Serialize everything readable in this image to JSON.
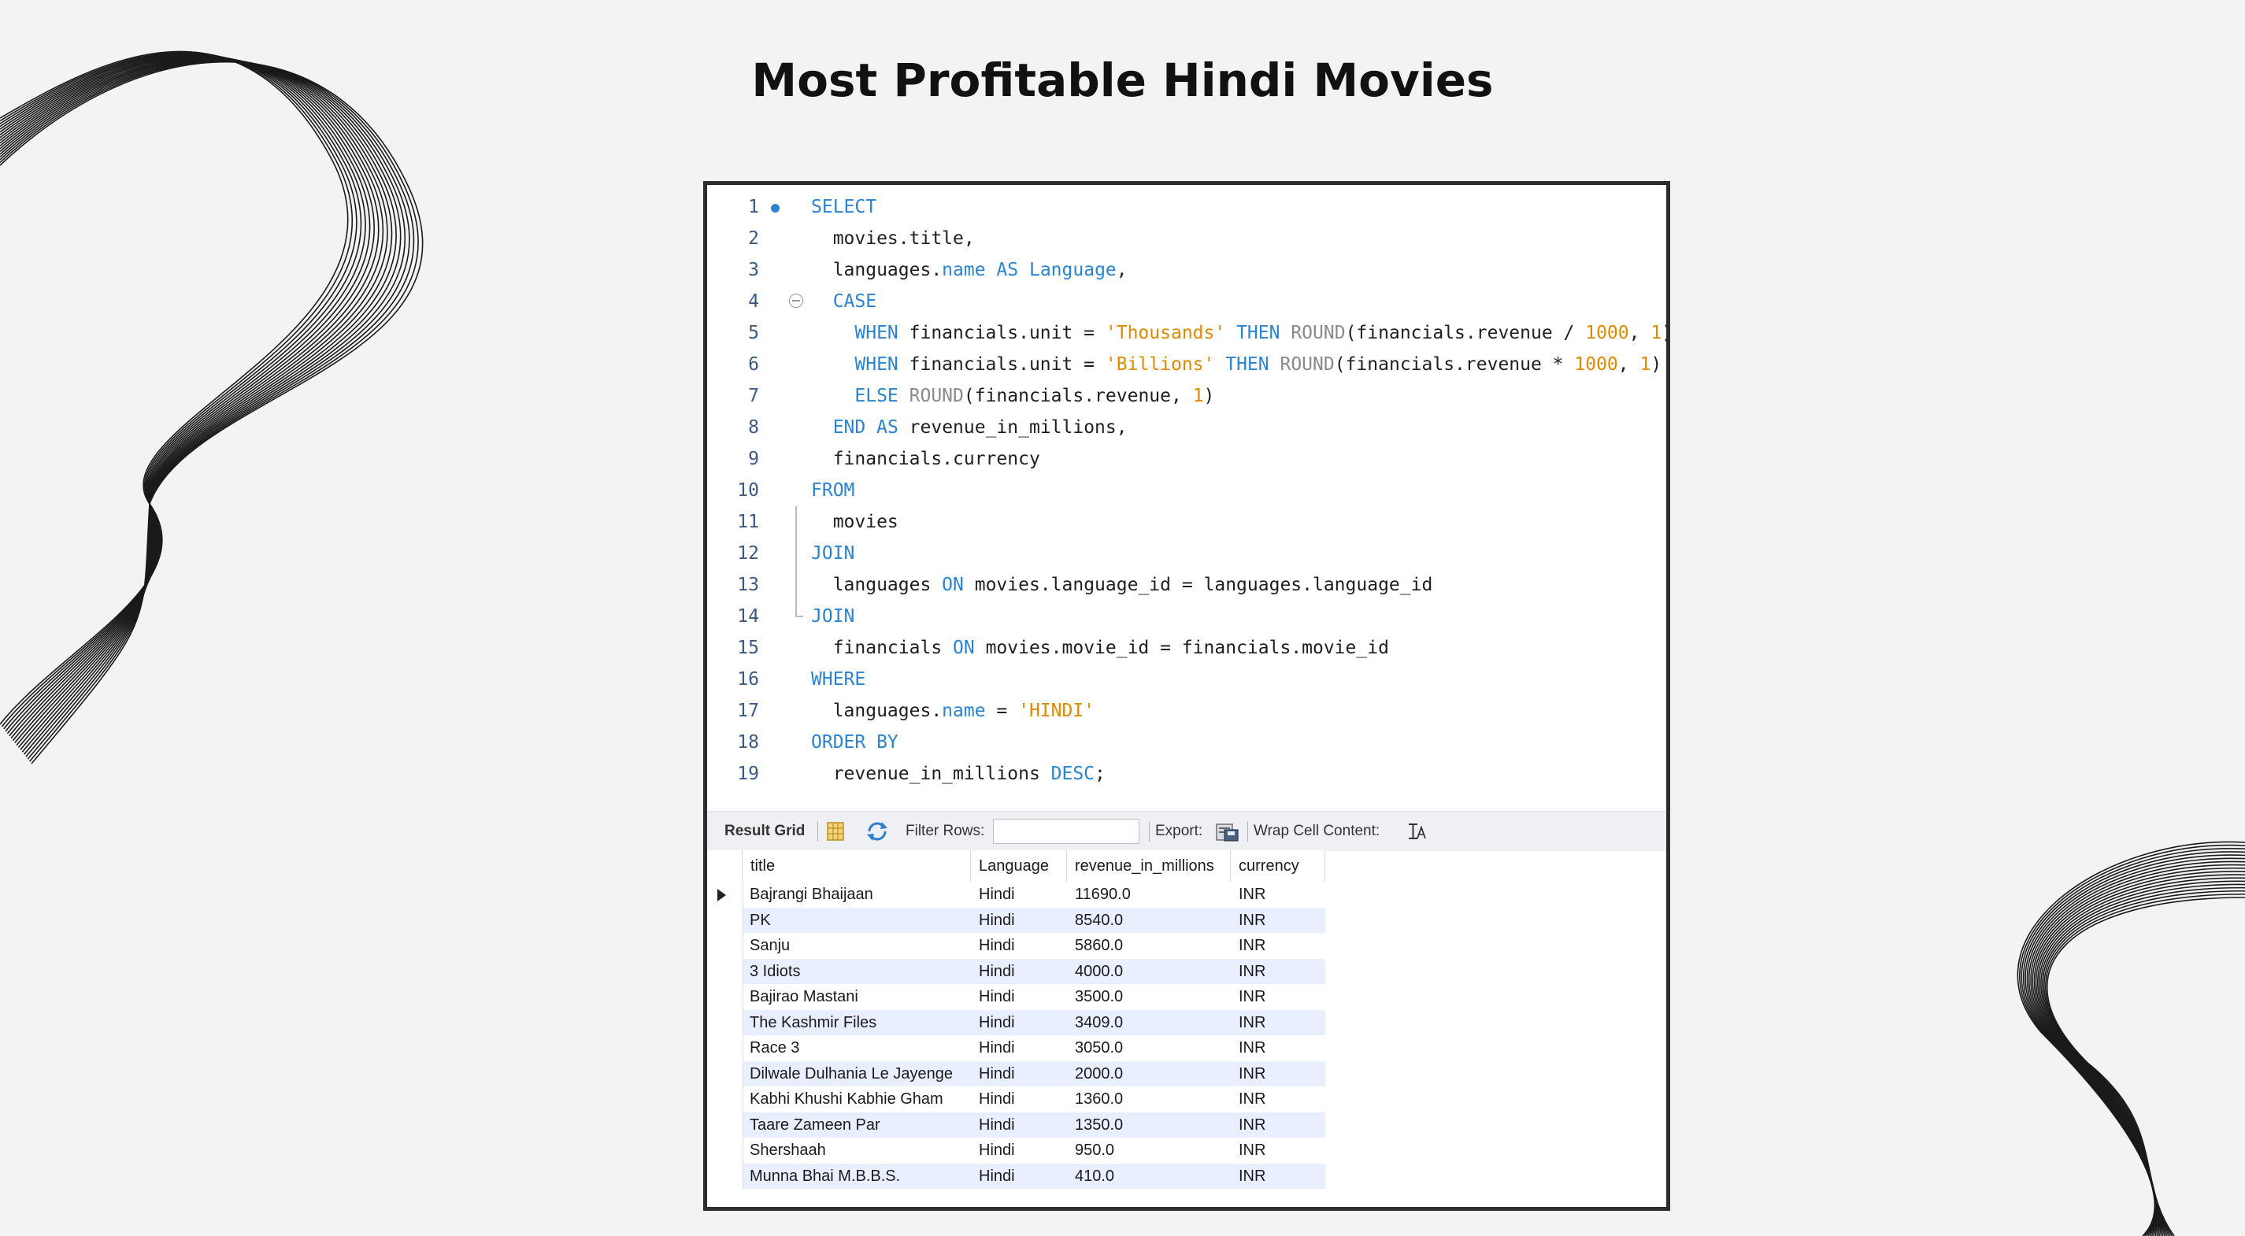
{
  "page": {
    "title": "Most Profitable Hindi Movies"
  },
  "colors": {
    "background": "#f2f3f5",
    "keyword": "#2a84d4",
    "string": "#e08a00",
    "function": "#8a8a8a",
    "line_number": "#3b5a85",
    "alt_row": "#e9efff"
  },
  "editor": {
    "lines": [
      {
        "n": "1",
        "segments": [
          [
            "kw",
            "SELECT"
          ]
        ]
      },
      {
        "n": "2",
        "segments": [
          [
            "t",
            "  movies.title,"
          ]
        ]
      },
      {
        "n": "3",
        "segments": [
          [
            "t",
            "  languages."
          ],
          [
            "kw",
            "name"
          ],
          [
            "t",
            " "
          ],
          [
            "kw",
            "AS"
          ],
          [
            "t",
            " "
          ],
          [
            "kw",
            "Language"
          ],
          [
            "t",
            ","
          ]
        ]
      },
      {
        "n": "4",
        "segments": [
          [
            "t",
            "  "
          ],
          [
            "kw",
            "CASE"
          ]
        ]
      },
      {
        "n": "5",
        "segments": [
          [
            "t",
            "    "
          ],
          [
            "kw",
            "WHEN"
          ],
          [
            "t",
            " financials.unit = "
          ],
          [
            "str",
            "'Thousands'"
          ],
          [
            "t",
            " "
          ],
          [
            "kw",
            "THEN"
          ],
          [
            "t",
            " "
          ],
          [
            "fn",
            "ROUND"
          ],
          [
            "t",
            "(financials.revenue / "
          ],
          [
            "num",
            "1000"
          ],
          [
            "t",
            ", "
          ],
          [
            "num",
            "1"
          ],
          [
            "t",
            ")"
          ]
        ]
      },
      {
        "n": "6",
        "segments": [
          [
            "t",
            "    "
          ],
          [
            "kw",
            "WHEN"
          ],
          [
            "t",
            " financials.unit = "
          ],
          [
            "str",
            "'Billions'"
          ],
          [
            "t",
            " "
          ],
          [
            "kw",
            "THEN"
          ],
          [
            "t",
            " "
          ],
          [
            "fn",
            "ROUND"
          ],
          [
            "t",
            "(financials.revenue * "
          ],
          [
            "num",
            "1000"
          ],
          [
            "t",
            ", "
          ],
          [
            "num",
            "1"
          ],
          [
            "t",
            ")"
          ]
        ]
      },
      {
        "n": "7",
        "segments": [
          [
            "t",
            "    "
          ],
          [
            "kw",
            "ELSE"
          ],
          [
            "t",
            " "
          ],
          [
            "fn",
            "ROUND"
          ],
          [
            "t",
            "(financials.revenue, "
          ],
          [
            "num",
            "1"
          ],
          [
            "t",
            ")"
          ]
        ]
      },
      {
        "n": "8",
        "segments": [
          [
            "t",
            "  "
          ],
          [
            "kw",
            "END"
          ],
          [
            "t",
            " "
          ],
          [
            "kw",
            "AS"
          ],
          [
            "t",
            " revenue_in_millions,"
          ]
        ]
      },
      {
        "n": "9",
        "segments": [
          [
            "t",
            "  financials.currency"
          ]
        ]
      },
      {
        "n": "10",
        "segments": [
          [
            "kw",
            "FROM"
          ]
        ]
      },
      {
        "n": "11",
        "segments": [
          [
            "t",
            "  movies"
          ]
        ]
      },
      {
        "n": "12",
        "segments": [
          [
            "kw",
            "JOIN"
          ]
        ]
      },
      {
        "n": "13",
        "segments": [
          [
            "t",
            "  languages "
          ],
          [
            "kw",
            "ON"
          ],
          [
            "t",
            " movies.language_id = languages.language_id"
          ]
        ]
      },
      {
        "n": "14",
        "segments": [
          [
            "kw",
            "JOIN"
          ]
        ]
      },
      {
        "n": "15",
        "segments": [
          [
            "t",
            "  financials "
          ],
          [
            "kw",
            "ON"
          ],
          [
            "t",
            " movies.movie_id = financials.movie_id"
          ]
        ]
      },
      {
        "n": "16",
        "segments": [
          [
            "kw",
            "WHERE"
          ]
        ]
      },
      {
        "n": "17",
        "segments": [
          [
            "t",
            "  languages."
          ],
          [
            "kw",
            "name"
          ],
          [
            "t",
            " = "
          ],
          [
            "str",
            "'HINDI'"
          ]
        ]
      },
      {
        "n": "18",
        "segments": [
          [
            "kw",
            "ORDER BY"
          ]
        ]
      },
      {
        "n": "19",
        "segments": [
          [
            "t",
            "  revenue_in_millions "
          ],
          [
            "kw",
            "DESC"
          ],
          [
            "t",
            ";"
          ]
        ]
      }
    ]
  },
  "toolbar": {
    "result_grid_label": "Result Grid",
    "grid_icon": "grid-view-icon",
    "refresh_icon": "refresh-icon",
    "filter_label": "Filter Rows:",
    "filter_value": "",
    "export_label": "Export:",
    "export_icon": "export-icon",
    "wrap_label": "Wrap Cell Content:",
    "wrap_icon": "wrap-text-icon"
  },
  "grid": {
    "columns": [
      "title",
      "Language",
      "revenue_in_millions",
      "currency"
    ],
    "rows": [
      [
        "Bajrangi Bhaijaan",
        "Hindi",
        "11690.0",
        "INR"
      ],
      [
        "PK",
        "Hindi",
        "8540.0",
        "INR"
      ],
      [
        "Sanju",
        "Hindi",
        "5860.0",
        "INR"
      ],
      [
        "3 Idiots",
        "Hindi",
        "4000.0",
        "INR"
      ],
      [
        "Bajirao Mastani",
        "Hindi",
        "3500.0",
        "INR"
      ],
      [
        "The Kashmir Files",
        "Hindi",
        "3409.0",
        "INR"
      ],
      [
        "Race 3",
        "Hindi",
        "3050.0",
        "INR"
      ],
      [
        "Dilwale Dulhania Le Jayenge",
        "Hindi",
        "2000.0",
        "INR"
      ],
      [
        "Kabhi Khushi Kabhie Gham",
        "Hindi",
        "1360.0",
        "INR"
      ],
      [
        "Taare Zameen Par",
        "Hindi",
        "1350.0",
        "INR"
      ],
      [
        "Shershaah",
        "Hindi",
        "950.0",
        "INR"
      ],
      [
        "Munna Bhai M.B.B.S.",
        "Hindi",
        "410.0",
        "INR"
      ]
    ]
  }
}
